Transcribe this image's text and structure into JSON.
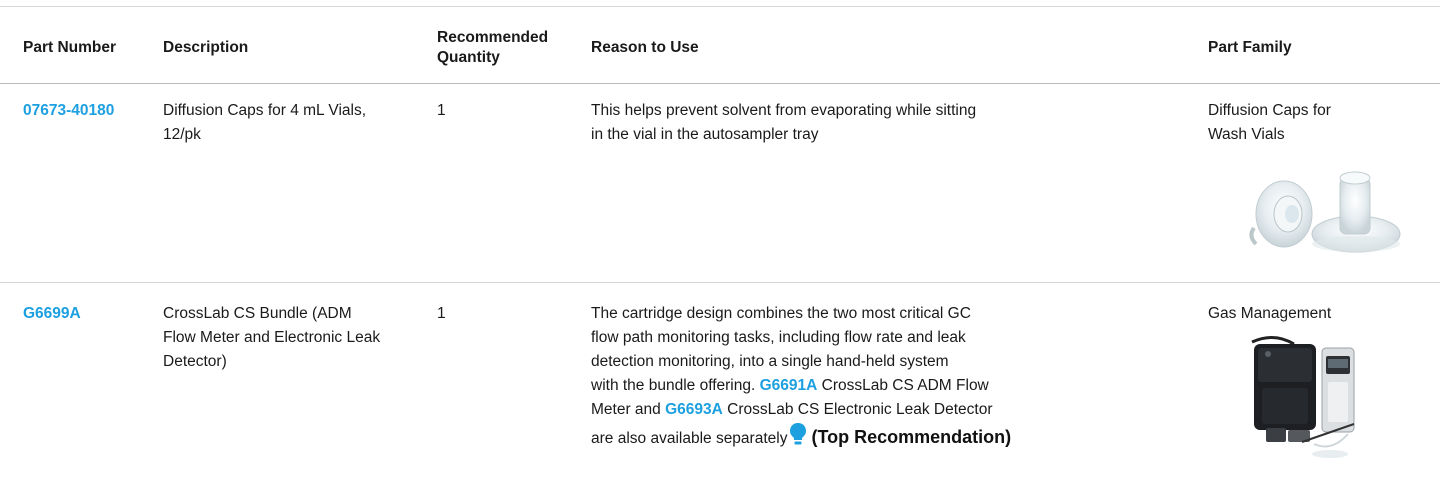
{
  "table": {
    "headers": {
      "part_number": "Part Number",
      "description": "Description",
      "quantity": "Recommended Quantity",
      "reason": "Reason to Use",
      "family": "Part Family"
    },
    "rows": [
      {
        "part_number": "07673-40180",
        "description": "Diffusion Caps for 4 mL Vials, 12/pk",
        "quantity": "1",
        "reason_line1": "This helps prevent solvent from evaporating while sitting",
        "reason_line2": "in the vial in the autosampler tray",
        "family": "Diffusion Caps for Wash Vials",
        "image_icon": "diffusion-caps-photo"
      },
      {
        "part_number": "G6699A",
        "description": "CrossLab CS Bundle (ADM Flow Meter and Electronic Leak Detector)",
        "quantity": "1",
        "reason": {
          "l1": "The cartridge design combines the two most critical GC",
          "l2": "flow path monitoring tasks, including flow rate and leak",
          "l3": "detection monitoring, into a single hand-held system",
          "l4_pre": "with the bundle offering. ",
          "link1": "G6691A",
          "l4_post": " CrossLab CS ADM Flow",
          "l5_pre": "Meter and ",
          "link2": "G6693A",
          "l5_post": " CrossLab CS Electronic Leak Detector",
          "l6": "are also available separately",
          "top_rec": "(Top Recommendation)",
          "top_rec_icon": "lightbulb-icon"
        },
        "family": "Gas Management",
        "image_icon": "gas-management-kit-photo"
      }
    ]
  },
  "colors": {
    "link": "#1da0e0",
    "divider": "#d8d8d8"
  }
}
